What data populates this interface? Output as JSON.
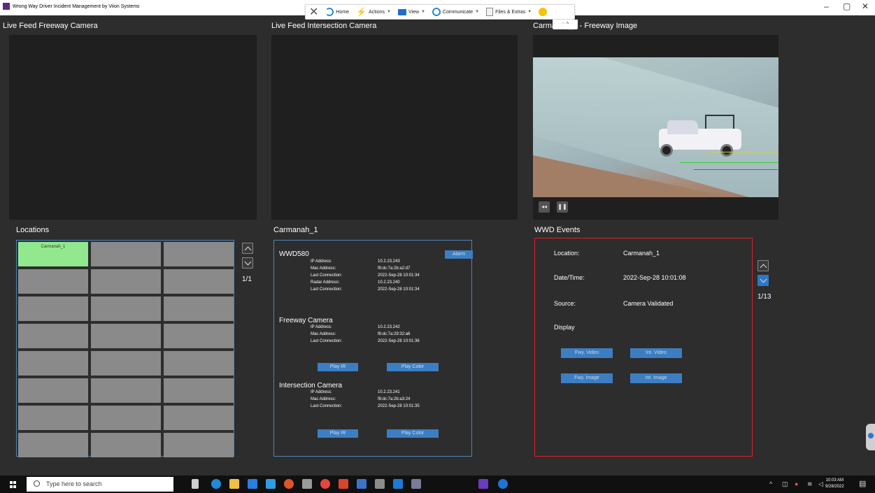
{
  "window": {
    "title": "Wrong Way Driver Incident Management by Viion Systems",
    "controls": [
      "–",
      "▢",
      "✕"
    ]
  },
  "remote_toolbar": {
    "close": "✕",
    "items": [
      {
        "label": "Home",
        "icon": "home-icon"
      },
      {
        "label": "Actions",
        "icon": "lightning-icon"
      },
      {
        "label": "View",
        "icon": "monitor-icon"
      },
      {
        "label": "Communicate",
        "icon": "communicate-icon"
      },
      {
        "label": "Files & Extras",
        "icon": "files-icon"
      }
    ],
    "collapse": ":: ^"
  },
  "headings": {
    "freeway_feed": "Live Feed Freeway Camera",
    "intersection_feed": "Live Feed Intersection Camera",
    "freeway_image": "Carmanah_1 - Freeway Image",
    "locations": "Locations",
    "device": "Carmanah_1",
    "events": "WWD Events"
  },
  "locations": {
    "cells": [
      "Carmanah_1",
      "",
      "",
      "",
      "",
      "",
      "",
      "",
      "",
      "",
      "",
      "",
      "",
      "",
      "",
      "",
      "",
      "",
      "",
      "",
      "",
      "",
      "",
      ""
    ],
    "page": "1/1"
  },
  "device": {
    "wwd": {
      "title": "WWD580",
      "alarm": "Alarm",
      "fields": [
        {
          "k": "IP Address:",
          "v": "10.2.23.243"
        },
        {
          "k": "Mac Address:",
          "v": "f8:dc:7a:2b:a2:d7"
        },
        {
          "k": "Last Connection:",
          "v": "2022-Sep-28 10:01:34"
        },
        {
          "k": "Radar Address:",
          "v": "10.2.23.240"
        },
        {
          "k": "Last Connection:",
          "v": "2022-Sep-28 10:01:34"
        }
      ]
    },
    "freeway": {
      "title": "Freeway Camera",
      "fields": [
        {
          "k": "IP Address:",
          "v": "10.2.23.242"
        },
        {
          "k": "Mac Address:",
          "v": "f8:dc:7a:29:32:a6"
        },
        {
          "k": "Last Connection:",
          "v": "2022-Sep-28 10:01:36"
        }
      ],
      "play_ir": "Play IR",
      "play_color": "Play Color"
    },
    "intersection": {
      "title": "Intersection Camera",
      "fields": [
        {
          "k": "IP Address:",
          "v": "10.2.23.241"
        },
        {
          "k": "Mac Address:",
          "v": "f8:dc:7a:2b:a3:24"
        },
        {
          "k": "Last Connection:",
          "v": "2022-Sep-28 10:01:35"
        }
      ],
      "play_ir": "Play IR",
      "play_color": "Play Color"
    }
  },
  "events": {
    "location_label": "Location:",
    "location": "Carmanah_1",
    "datetime_label": "Date/Time:",
    "datetime": "2022-Sep-28 10:01:08",
    "source_label": "Source:",
    "source": "Camera Validated",
    "display_label": "Display",
    "fwy_video": "Fwy. Video",
    "int_video": "Int. Video",
    "fwy_image": "Fwy. Image",
    "int_image": "Int. Image",
    "page": "1/13"
  },
  "image_controls": {
    "rewind": "◂◂",
    "pause": "❚❚"
  },
  "taskbar": {
    "search_placeholder": "Type here to search",
    "time": "10:03 AM",
    "date": "9/28/2022"
  },
  "colors": {
    "accent_blue": "#3d7ec2",
    "selected_green": "#92e88c",
    "events_border": "#e0202a",
    "panel_border": "#4a84b8"
  }
}
